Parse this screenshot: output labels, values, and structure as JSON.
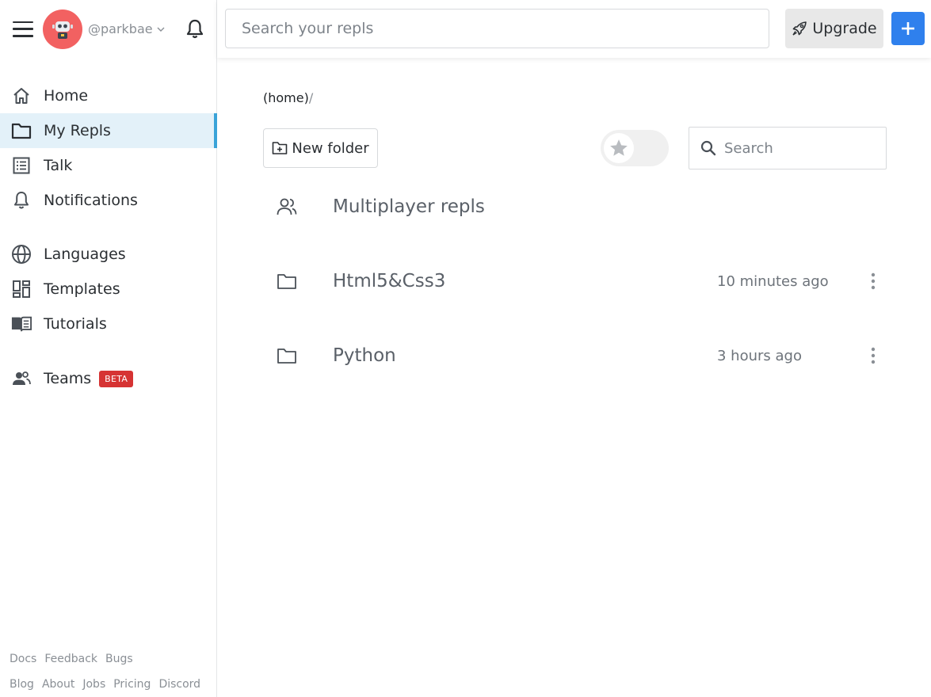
{
  "sidebar": {
    "username": "@parkbae",
    "nav": [
      {
        "label": "Home",
        "icon": "home-icon"
      },
      {
        "label": "My Repls",
        "icon": "folder-icon",
        "active": true
      },
      {
        "label": "Talk",
        "icon": "list-icon"
      },
      {
        "label": "Notifications",
        "icon": "bell-icon"
      },
      {
        "label": "Languages",
        "icon": "globe-icon"
      },
      {
        "label": "Templates",
        "icon": "templates-icon"
      },
      {
        "label": "Tutorials",
        "icon": "book-icon"
      },
      {
        "label": "Teams",
        "icon": "users-icon",
        "badge": "BETA"
      }
    ],
    "footer_row1": [
      "Docs",
      "Feedback",
      "Bugs"
    ],
    "footer_row2": [
      "Blog",
      "About",
      "Jobs",
      "Pricing",
      "Discord"
    ]
  },
  "topbar": {
    "search_placeholder": "Search your repls",
    "upgrade_label": "Upgrade"
  },
  "main": {
    "breadcrumb": "(home)",
    "breadcrumb_sep": "/",
    "new_folder_label": "New folder",
    "search_placeholder": "Search",
    "items": [
      {
        "name": "Multiplayer repls",
        "time": "",
        "icon": "users-icon"
      },
      {
        "name": "Html5&Css3",
        "time": "10 minutes ago",
        "icon": "folder-icon"
      },
      {
        "name": "Python",
        "time": "3 hours ago",
        "icon": "folder-icon"
      }
    ]
  },
  "colors": {
    "accent": "#3aa3d8",
    "active_bg": "#e3f1f9",
    "primary_button": "#2f80ed",
    "avatar_bg": "#f26161",
    "beta_badge": "#d63333"
  }
}
